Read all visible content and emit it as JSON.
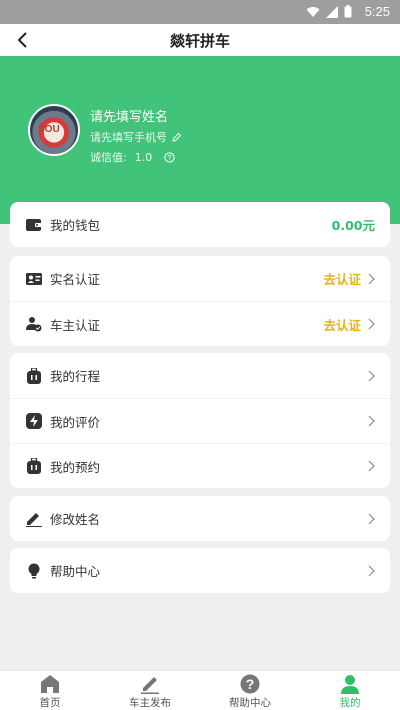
{
  "status_bar": {
    "time": "5:25"
  },
  "nav": {
    "title": "燚轩拼车"
  },
  "profile": {
    "name": "请先填写姓名",
    "phone_hint": "请先填写手机号",
    "credit_label": "诚信值:",
    "credit_value": "1.0"
  },
  "wallet": {
    "label": "我的钱包",
    "balance": "0.00元"
  },
  "verification": [
    {
      "label": "实名认证",
      "action": "去认证"
    },
    {
      "label": "车主认证",
      "action": "去认证"
    }
  ],
  "activity": [
    {
      "label": "我的行程"
    },
    {
      "label": "我的评价"
    },
    {
      "label": "我的预约"
    }
  ],
  "edit": {
    "label": "修改姓名"
  },
  "help": {
    "label": "帮助中心"
  },
  "tabs": [
    {
      "label": "首页",
      "icon": "home-icon"
    },
    {
      "label": "车主发布",
      "icon": "pencil-icon"
    },
    {
      "label": "帮助中心",
      "icon": "question-icon"
    },
    {
      "label": "我的",
      "icon": "person-icon"
    }
  ],
  "colors": {
    "accent": "#42c37a",
    "warning": "#e8b21c",
    "status_bar": "#9e9e9e"
  }
}
